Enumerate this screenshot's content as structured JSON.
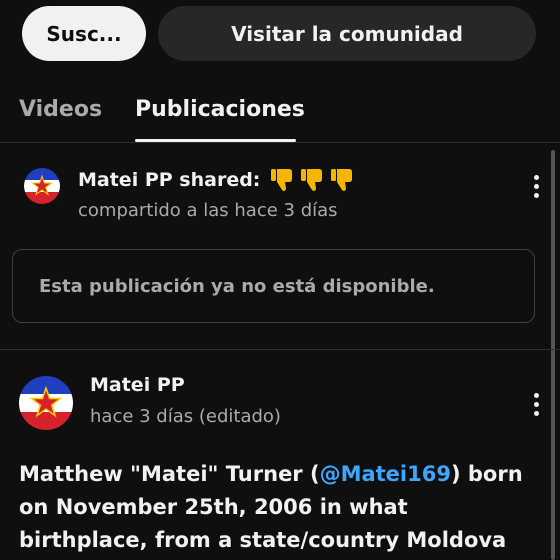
{
  "actions": {
    "subscribe_label": "Susc...",
    "community_label": "Visitar la comunidad"
  },
  "tabs": [
    {
      "label": "Videos",
      "selected": false
    },
    {
      "label": "Publicaciones",
      "selected": true
    }
  ],
  "posts": [
    {
      "title": "Matei PP shared:",
      "reaction_icons": [
        "thumbs-down-icon",
        "thumbs-down-icon",
        "thumbs-down-icon"
      ],
      "meta": "compartido a las hace 3 días",
      "unavailable_notice": "Esta publicación ya no está disponible."
    },
    {
      "author": "Matei PP",
      "meta": "hace 3 días (editado)",
      "body": {
        "line1_before": "Matthew \"Matei\" Turner (",
        "mention": "@Matei169",
        "line1_after": ") born",
        "line2": "on November 25th, 2006 in what",
        "line3": "birthplace, from a state/country Moldova"
      }
    }
  ],
  "colors": {
    "background": "#0f0f0f",
    "mention": "#3ea6ff",
    "secondary_text": "#aaaaaa",
    "emoji": "#f5b500"
  }
}
